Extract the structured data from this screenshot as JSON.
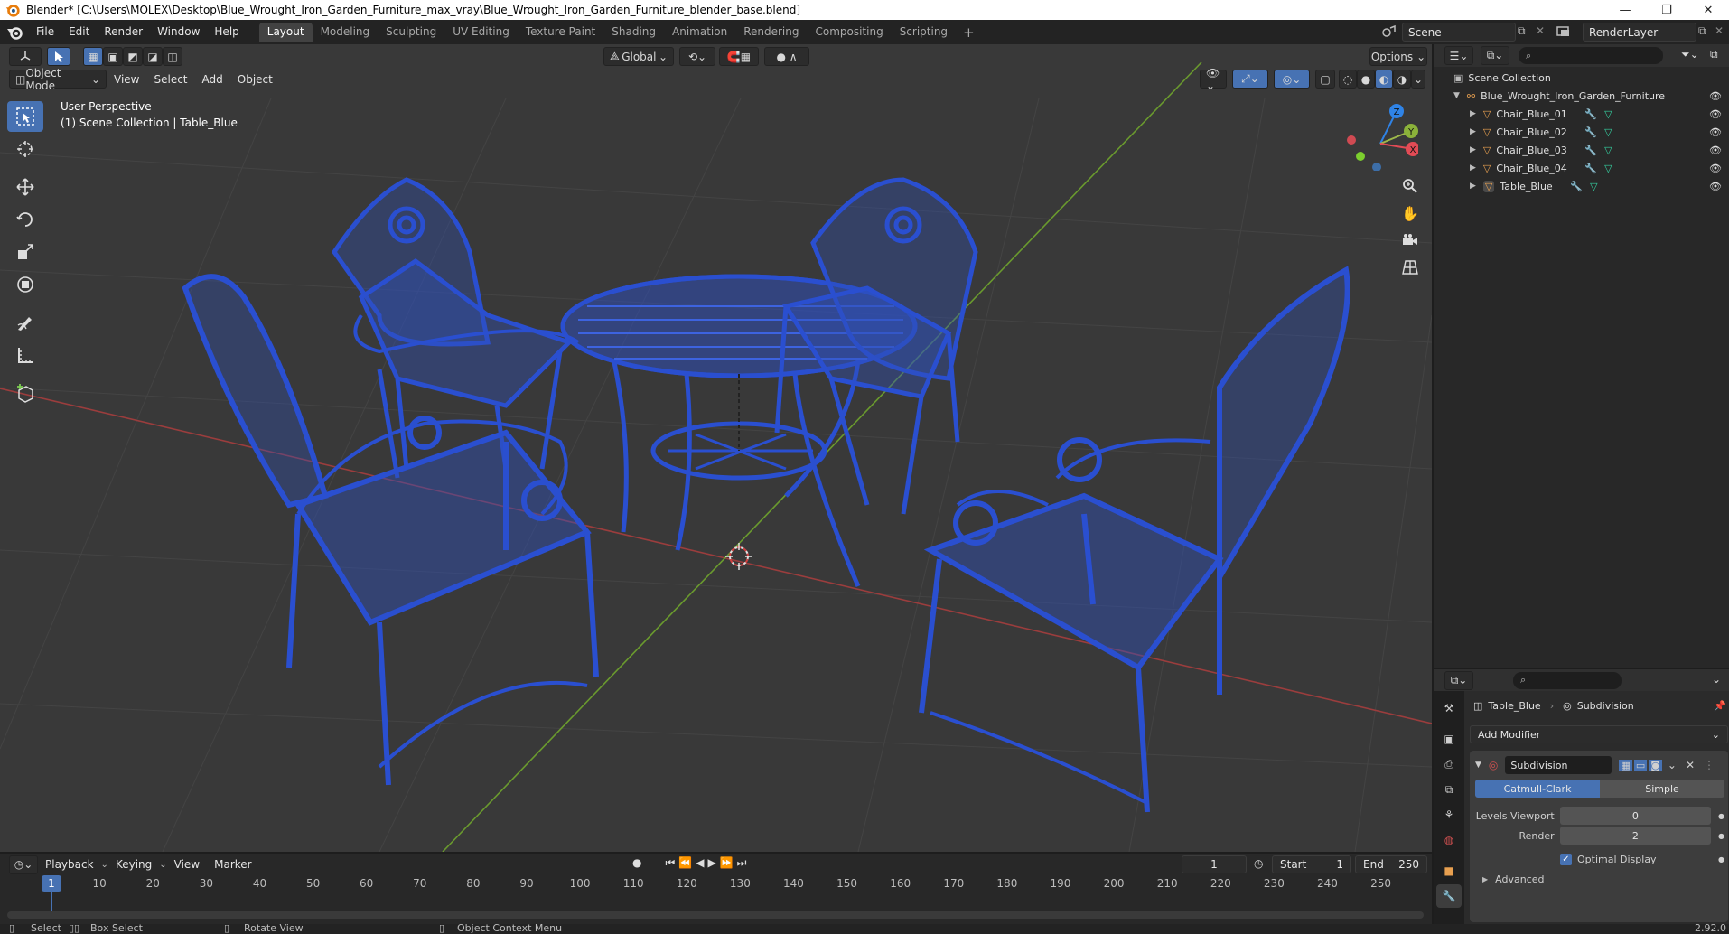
{
  "window": {
    "title": "Blender* [C:\\Users\\MOLEX\\Desktop\\Blue_Wrought_Iron_Garden_Furniture_max_vray\\Blue_Wrought_Iron_Garden_Furniture_blender_base.blend]",
    "controls": [
      "—",
      "❐",
      "✕"
    ]
  },
  "menu": [
    "File",
    "Edit",
    "Render",
    "Window",
    "Help"
  ],
  "workspaces": {
    "active": "Layout",
    "tabs": [
      "Layout",
      "Modeling",
      "Sculpting",
      "UV Editing",
      "Texture Paint",
      "Shading",
      "Animation",
      "Rendering",
      "Compositing",
      "Scripting"
    ],
    "add": "+"
  },
  "scene": {
    "name": "Scene",
    "view_layer": "RenderLayer"
  },
  "viewport": {
    "mode": "Object Mode",
    "menus": [
      "View",
      "Select",
      "Add",
      "Object"
    ],
    "transform_orientation": "Global",
    "options_label": "Options",
    "overlay_title": "User Perspective",
    "overlay_subtitle": "(1) Scene Collection | Table_Blue",
    "axis_labels": {
      "x": "X",
      "y": "Y",
      "z": "Z"
    },
    "mesh_color": "#2a4fd0",
    "tools": [
      "select-box",
      "cursor",
      "move",
      "rotate",
      "scale",
      "transform",
      "annotate",
      "measure",
      "add-cube"
    ]
  },
  "timeline": {
    "menus": [
      "Playback",
      "Keying",
      "View",
      "Marker"
    ],
    "current_frame": "1",
    "start_label": "Start",
    "start": "1",
    "end_label": "End",
    "end": "250",
    "ticks": [
      "1",
      "10",
      "20",
      "30",
      "40",
      "50",
      "60",
      "70",
      "80",
      "90",
      "100",
      "110",
      "120",
      "130",
      "140",
      "150",
      "160",
      "170",
      "180",
      "190",
      "200",
      "210",
      "220",
      "230",
      "240",
      "250"
    ]
  },
  "outliner": {
    "root": "Scene Collection",
    "collection": "Blue_Wrought_Iron_Garden_Furniture",
    "objects": [
      "Chair_Blue_01",
      "Chair_Blue_02",
      "Chair_Blue_03",
      "Chair_Blue_04",
      "Table_Blue"
    ]
  },
  "properties": {
    "object": "Table_Blue",
    "modifier_tab": "Subdivision",
    "add_modifier": "Add Modifier",
    "modifier_name": "Subdivision",
    "algo_active": "Catmull-Clark",
    "algo_other": "Simple",
    "levels_viewport_label": "Levels Viewport",
    "levels_viewport": "0",
    "render_label": "Render",
    "render": "2",
    "optimal_display": "Optimal Display",
    "advanced": "Advanced"
  },
  "status": {
    "select": "Select",
    "box_select": "Box Select",
    "rotate_view": "Rotate View",
    "context_menu": "Object Context Menu",
    "version": "2.92.0"
  }
}
